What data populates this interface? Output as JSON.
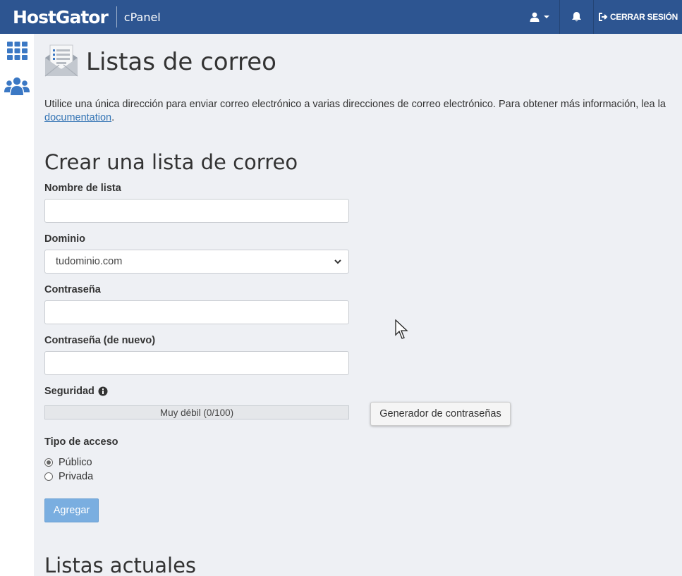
{
  "header": {
    "brand": "HostGator",
    "product": "cPanel",
    "logout_label": "CERRAR SESIÓN",
    "icons": [
      "user-icon",
      "bell-icon",
      "logout-icon"
    ]
  },
  "sidebar": {
    "items": [
      {
        "icon": "grid-icon"
      },
      {
        "icon": "users-icon"
      }
    ]
  },
  "page": {
    "title": "Listas de correo",
    "intro_text": "Utilice una única dirección para enviar correo electrónico a varias direcciones de correo electrónico. Para obtener más información, lea la ",
    "intro_link": "documentation",
    "intro_end": "."
  },
  "form": {
    "section_title": "Crear una lista de correo",
    "list_name_label": "Nombre de lista",
    "list_name_value": "",
    "domain_label": "Dominio",
    "domain_value": "tudominio.com",
    "password_label": "Contraseña",
    "password_value": "",
    "password_again_label": "Contraseña (de nuevo)",
    "password_again_value": "",
    "security_label": "Seguridad",
    "strength_text": "Muy débil (0/100)",
    "strength_score": 0,
    "generator_label": "Generador de contraseñas",
    "access_label": "Tipo de acceso",
    "access_options": [
      {
        "label": "Público",
        "selected": true
      },
      {
        "label": "Privada",
        "selected": false
      }
    ],
    "add_label": "Agregar"
  },
  "current_lists": {
    "title": "Listas actuales"
  },
  "colors": {
    "header_bg": "#2d5591",
    "accent": "#7aaee0",
    "link": "#3575b5",
    "page_bg": "#eef0f4"
  }
}
